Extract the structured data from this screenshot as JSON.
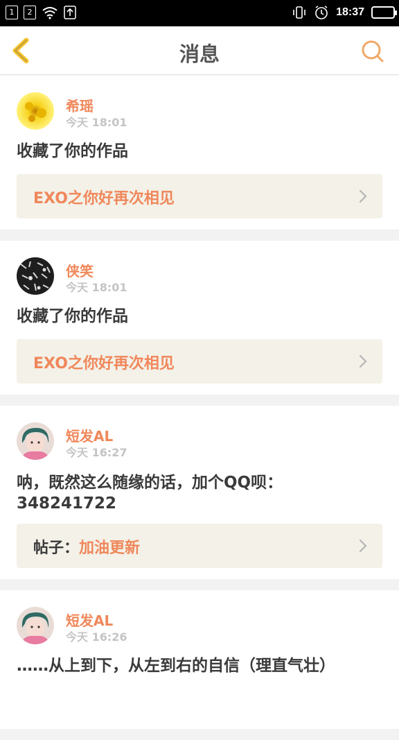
{
  "status_bar": {
    "sim1": "1",
    "sim2": "2",
    "time": "18:37"
  },
  "header": {
    "title": "消息",
    "back_icon": "chevron-left-icon",
    "search_icon": "search-icon"
  },
  "colors": {
    "accent": "#f0875a",
    "back_icon": "#f7c431",
    "link_bg": "#f3f1e8"
  },
  "messages": [
    {
      "user": "希瑶",
      "time": "今天 18:01",
      "text": "收藏了你的作品",
      "link_prefix": "",
      "link": "EXO之你好再次相见"
    },
    {
      "user": "侠笑",
      "time": "今天 18:01",
      "text": "收藏了你的作品",
      "link_prefix": "",
      "link": "EXO之你好再次相见"
    },
    {
      "user": "短发AL",
      "time": "今天 16:27",
      "text": "呐，既然这么随缘的话，加个QQ呗：348241722",
      "link_prefix": "帖子：",
      "link": "加油更新"
    },
    {
      "user": "短发AL",
      "time": "今天 16:26",
      "text": "……从上到下，从左到右的自信（理直气壮）",
      "link_prefix": "",
      "link": ""
    }
  ]
}
